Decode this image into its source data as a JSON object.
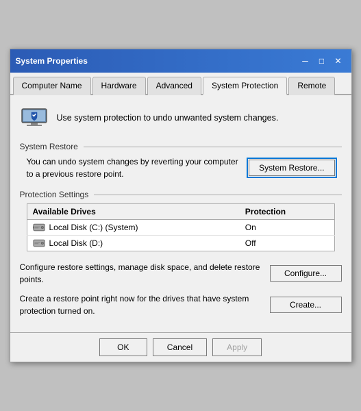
{
  "window": {
    "title": "System Properties",
    "close_button": "✕",
    "minimize_button": "─",
    "maximize_button": "□"
  },
  "tabs": [
    {
      "id": "computer-name",
      "label": "Computer Name",
      "active": false
    },
    {
      "id": "hardware",
      "label": "Hardware",
      "active": false
    },
    {
      "id": "advanced",
      "label": "Advanced",
      "active": false
    },
    {
      "id": "system-protection",
      "label": "System Protection",
      "active": true
    },
    {
      "id": "remote",
      "label": "Remote",
      "active": false
    }
  ],
  "top_info": {
    "text": "Use system protection to undo unwanted system changes."
  },
  "system_restore": {
    "section_title": "System Restore",
    "description": "You can undo system changes by reverting your computer to a previous restore point.",
    "button_label": "System Restore..."
  },
  "protection_settings": {
    "section_title": "Protection Settings",
    "columns": [
      "Available Drives",
      "Protection"
    ],
    "drives": [
      {
        "icon": "hdd-system",
        "name": "Local Disk (C:) (System)",
        "protection": "On"
      },
      {
        "icon": "hdd",
        "name": "Local Disk (D:)",
        "protection": "Off"
      }
    ]
  },
  "configure": {
    "description": "Configure restore settings, manage disk space, and delete restore points.",
    "button_label": "Configure..."
  },
  "create": {
    "description": "Create a restore point right now for the drives that have system protection turned on.",
    "button_label": "Create..."
  },
  "footer": {
    "ok_label": "OK",
    "cancel_label": "Cancel",
    "apply_label": "Apply"
  }
}
